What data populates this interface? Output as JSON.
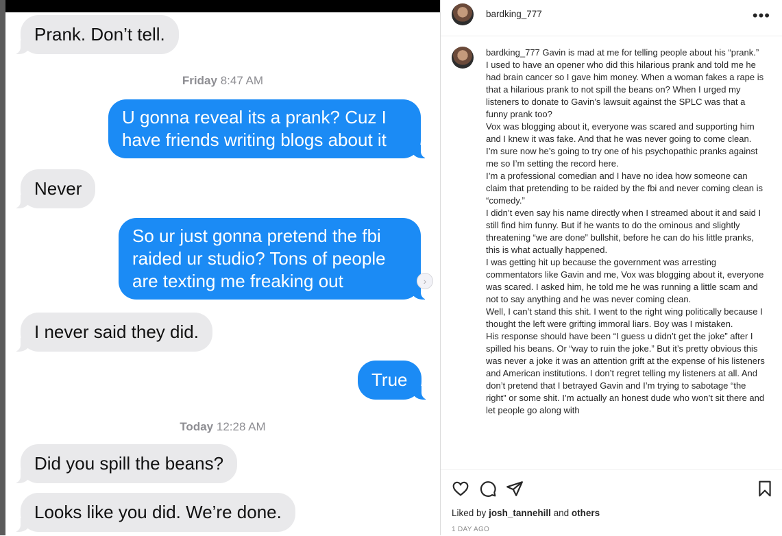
{
  "messages": {
    "m1": "Prank. Don’t tell.",
    "ts1_day": "Friday",
    "ts1_time": "8:47 AM",
    "m2": "U gonna reveal its a prank? Cuz I\nhave friends writing blogs about it",
    "m3": "Never",
    "m4": "So ur just gonna pretend the fbi\nraided ur studio? Tons of people\nare texting me freaking out",
    "m5": "I never said they did.",
    "m6": "True",
    "ts2_day": "Today",
    "ts2_time": "12:28 AM",
    "m7": "Did you spill the beans?",
    "m8": "Looks like you did. We’re done."
  },
  "post": {
    "username": "bardking_777",
    "more_glyph": "•••",
    "caption_user": "bardking_777",
    "caption": [
      "Gavin is mad at me for telling people about his “prank.”",
      "I used to have an opener who did this hilarious prank and told me he had brain cancer so I gave him money. When a woman fakes a rape is that a hilarious prank to not spill the beans on? When I urged my listeners to donate to Gavin’s lawsuit against the SPLC was that a funny prank too?",
      "Vox was blogging about it, everyone was scared and supporting him and I knew it was fake. And that he was never going to come clean.",
      "I’m sure now he’s going to try one of his psychopathic pranks against me so I’m setting the record here.",
      "I’m a professional comedian and I have no idea how someone can claim that pretending to be raided by the fbi and never coming clean is “comedy.”",
      "I didn’t even say his name directly when I streamed about it and said I still find him funny. But if he wants to do the ominous and slightly threatening “we are done” bullshit, before he can do his little pranks, this is what actually happened.",
      "I was getting hit up because the government was arresting commentators like Gavin and me, Vox was blogging about it, everyone was scared. I asked him, he told me he was running a little scam and not to say anything and he was never coming clean.",
      "Well, I can’t stand this shit. I went to the right wing politically because I thought the left were grifting immoral liars. Boy was I mistaken.",
      "His response should have been “I guess u didn’t get the joke” after I spilled his beans. Or “way to ruin the joke.” But it’s pretty obvious this was never a joke it was an attention grift at the expense of his listeners and American institutions. I don’t regret telling my listeners at all. And don’t pretend that I betrayed Gavin and I’m trying to sabotage “the right” or some shit. I’m actually an honest dude who won’t sit there and let people go along with"
    ],
    "liked_by_prefix": "Liked by",
    "liked_by_user": "josh_tannehill",
    "liked_by_and": "and",
    "liked_by_others": "others",
    "age": "1 DAY AGO",
    "icons": [
      "heart-icon",
      "comment-icon",
      "share-icon",
      "bookmark-icon"
    ]
  }
}
